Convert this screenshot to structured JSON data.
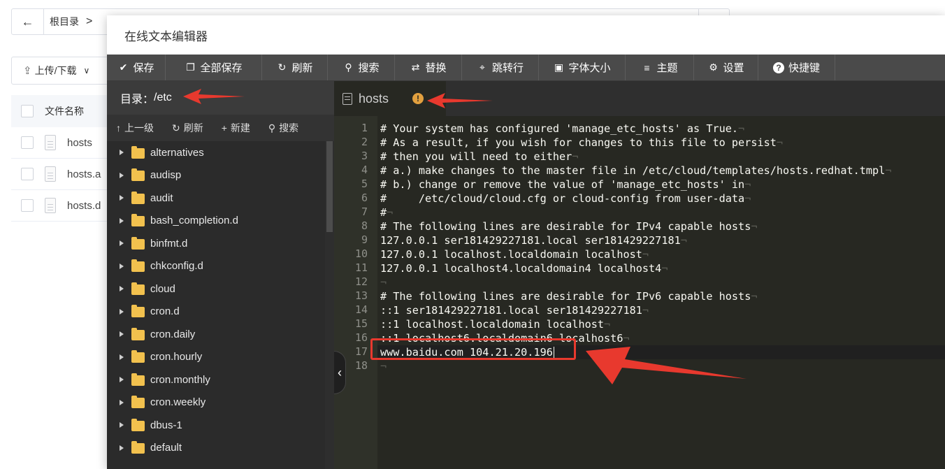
{
  "background": {
    "breadcrumb_root": "根目录",
    "upload_label": "上传/下载",
    "table_header": "文件名称",
    "files": [
      "hosts",
      "hosts.a",
      "hosts.d"
    ]
  },
  "editor": {
    "title": "在线文本编辑器",
    "toolbar": [
      {
        "label": "保存",
        "icon": "check-icon"
      },
      {
        "label": "全部保存",
        "icon": "copy-icon"
      },
      {
        "label": "刷新",
        "icon": "refresh-icon"
      },
      {
        "label": "搜索",
        "icon": "search-icon"
      },
      {
        "label": "替换",
        "icon": "replace-icon"
      },
      {
        "label": "跳转行",
        "icon": "location-icon"
      },
      {
        "label": "字体大小",
        "icon": "font-size-icon"
      },
      {
        "label": "主题",
        "icon": "menu-icon"
      },
      {
        "label": "设置",
        "icon": "gear-icon"
      },
      {
        "label": "快捷键",
        "icon": "help-icon"
      }
    ],
    "directory_label": "目录：",
    "directory_path": "/etc",
    "side_tools": [
      {
        "label": "上一级",
        "icon": "arrow-up-icon"
      },
      {
        "label": "刷新",
        "icon": "refresh-icon"
      },
      {
        "label": "新建",
        "icon": "plus-icon"
      },
      {
        "label": "搜索",
        "icon": "search-icon"
      }
    ],
    "tree": [
      "alternatives",
      "audisp",
      "audit",
      "bash_completion.d",
      "binfmt.d",
      "chkconfig.d",
      "cloud",
      "cron.d",
      "cron.daily",
      "cron.hourly",
      "cron.monthly",
      "cron.weekly",
      "dbus-1",
      "default"
    ],
    "tab": {
      "name": "hosts",
      "status": "!"
    },
    "lines": [
      "# Your system has configured 'manage_etc_hosts' as True.",
      "# As a result, if you wish for changes to this file to persist",
      "# then you will need to either",
      "# a.) make changes to the master file in /etc/cloud/templates/hosts.redhat.tmpl",
      "# b.) change or remove the value of 'manage_etc_hosts' in",
      "#     /etc/cloud/cloud.cfg or cloud-config from user-data",
      "#",
      "# The following lines are desirable for IPv4 capable hosts",
      "127.0.0.1 ser181429227181.local ser181429227181",
      "127.0.0.1 localhost.localdomain localhost",
      "127.0.0.1 localhost4.localdomain4 localhost4",
      "",
      "# The following lines are desirable for IPv6 capable hosts",
      "::1 ser181429227181.local ser181429227181",
      "::1 localhost.localdomain localhost",
      "::1 localhost6.localdomain6 localhost6",
      "www.baidu.com 104.21.20.196",
      ""
    ],
    "active_line": 17
  },
  "colors": {
    "annotation_red": "#e8392e",
    "toolbar_bg": "#4a4a4a",
    "editor_bg": "#272822",
    "folder": "#f2c14e",
    "warning": "#e2a03f"
  }
}
